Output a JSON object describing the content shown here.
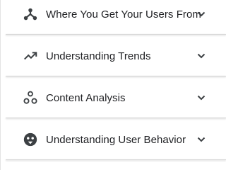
{
  "accordion": {
    "items": [
      {
        "label": "Where You Get Your Users From",
        "icon": "hub-icon",
        "expanded": false
      },
      {
        "label": "Understanding Trends",
        "icon": "trending-up-icon",
        "expanded": false
      },
      {
        "label": "Content Analysis",
        "icon": "bubbles-icon",
        "expanded": false
      },
      {
        "label": "Understanding User Behavior",
        "icon": "face-icon",
        "expanded": false
      }
    ]
  },
  "colors": {
    "text": "#202124",
    "icon": "#3c4043",
    "divider": "#d6d6d6"
  }
}
